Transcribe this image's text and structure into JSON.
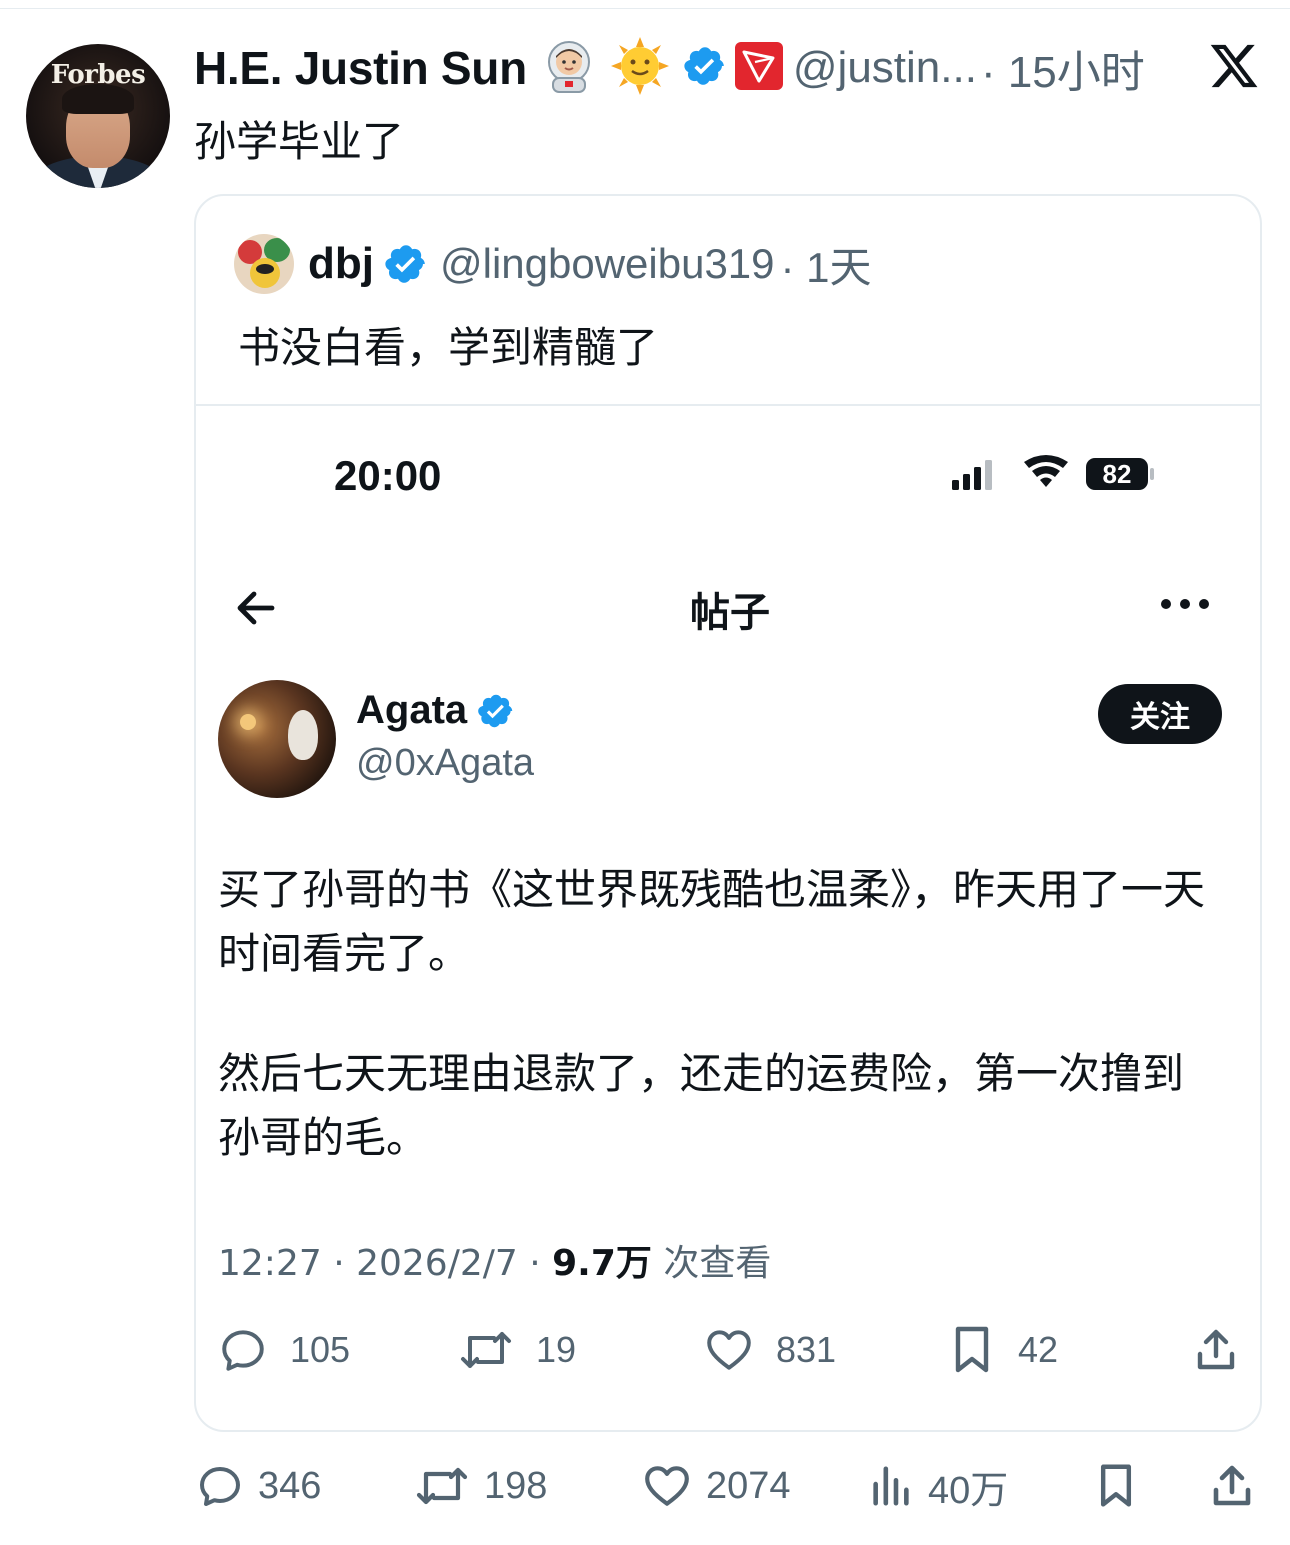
{
  "main_tweet": {
    "author_name": "H.E. Justin Sun",
    "handle": "@justin...",
    "time": "· 15小时",
    "text": "孙学毕业了",
    "avatar_text": "Forbes",
    "emojis": [
      "astronaut-icon",
      "sun-face-icon"
    ],
    "badges": [
      "verified-badge-icon",
      "tron-logo-icon"
    ]
  },
  "quoted_tweet": {
    "author_name": "dbj",
    "handle": "@lingboweibu319",
    "time": "· 1天",
    "text": "书没白看，学到精髓了"
  },
  "embedded_screenshot": {
    "status_time": "20:00",
    "battery": "82",
    "page_title": "帖子",
    "author_name": "Agata",
    "handle": "@0xAgata",
    "follow_label": "关注",
    "paragraph_1": "买了孙哥的书《这世界既残酷也温柔》，昨天用了一天时间看完了。",
    "paragraph_2": "然后七天无理由退款了，还走的运费险，第一次撸到孙哥的毛。",
    "timestamp": "12:27 · 2026/2/7 · ",
    "views": "9.7万",
    "views_suffix": " 次查看",
    "stats": {
      "replies": "105",
      "retweets": "19",
      "likes": "831",
      "bookmarks": "42"
    }
  },
  "outer_stats": {
    "replies": "346",
    "retweets": "198",
    "likes": "2074",
    "views": "40万"
  },
  "colors": {
    "text_primary": "#0f1419",
    "text_secondary": "#536471",
    "verified_blue": "#1d9bf0",
    "tron_red": "#e2262e",
    "border": "#e6ecf0"
  }
}
